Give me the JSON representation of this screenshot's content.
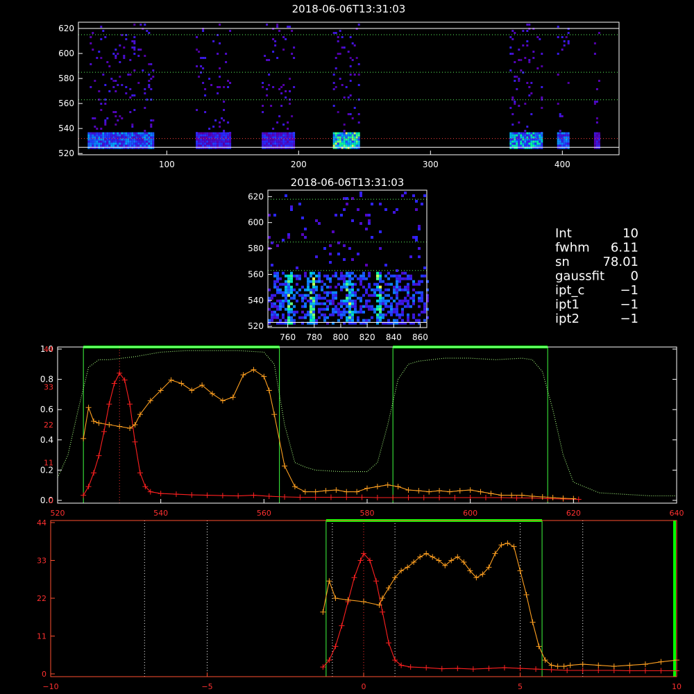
{
  "chart_data": [
    {
      "id": "panel1",
      "type": "heatmap",
      "title": "2018-06-06T13:31:03",
      "xlim": [
        33,
        443
      ],
      "ylim": [
        519,
        625
      ],
      "xticks": [
        100,
        200,
        300,
        400
      ],
      "yticks": [
        520,
        540,
        560,
        580,
        600,
        620
      ],
      "guides_y": [
        615,
        585,
        563,
        532
      ],
      "bands": [
        {
          "x": [
            40,
            90
          ],
          "intensity": 0.6
        },
        {
          "x": [
            122,
            148
          ],
          "intensity": 0.45
        },
        {
          "x": [
            172,
            197
          ],
          "intensity": 0.45
        },
        {
          "x": [
            226,
            245
          ],
          "intensity": 0.9
        },
        {
          "x": [
            360,
            385
          ],
          "intensity": 0.75
        },
        {
          "x": [
            396,
            405
          ],
          "intensity": 0.6
        },
        {
          "x": [
            424,
            428
          ],
          "intensity": 0.4
        }
      ]
    },
    {
      "id": "panel2",
      "type": "heatmap",
      "title": "2018-06-06T13:31:03",
      "xlim": [
        745,
        865
      ],
      "ylim": [
        519,
        625
      ],
      "xticks": [
        760,
        780,
        800,
        820,
        840,
        860
      ],
      "yticks": [
        520,
        540,
        560,
        580,
        600,
        620
      ],
      "guides_y": [
        618,
        585,
        563
      ],
      "hot_columns": [
        760,
        778,
        805,
        828
      ]
    },
    {
      "id": "panel3",
      "type": "line",
      "xlim": [
        520,
        640
      ],
      "xticks": [
        520,
        540,
        560,
        580,
        600,
        620,
        640
      ],
      "yticks_left": [
        "0.0",
        "0.2",
        "0.4",
        "0.6",
        "0.8",
        "1.0"
      ],
      "yticks_red": [
        "0",
        "11",
        "22",
        "33",
        "44"
      ],
      "green_bands": [
        [
          525,
          563
        ],
        [
          585,
          615
        ]
      ],
      "red_center": 532,
      "series": [
        {
          "color": "#ff2020",
          "x": [
            525,
            526,
            527,
            528,
            529,
            530,
            531,
            532,
            533,
            534,
            535,
            536,
            537,
            538,
            540,
            543,
            546,
            549,
            552,
            555,
            558,
            561,
            564,
            567,
            570,
            573,
            576,
            579,
            582,
            585,
            588,
            591,
            594,
            597,
            600,
            603,
            606,
            609,
            612,
            615,
            618,
            621
          ],
          "values": [
            1.5,
            4,
            8,
            13,
            20,
            28,
            34,
            37,
            35,
            28,
            17,
            8,
            4,
            2.5,
            2,
            1.8,
            1.6,
            1.5,
            1.4,
            1.3,
            1.5,
            1.2,
            1.0,
            0.9,
            0.9,
            0.9,
            0.9,
            0.9,
            0.8,
            0.8,
            0.8,
            0.8,
            0.8,
            0.8,
            0.8,
            0.8,
            0.8,
            0.7,
            0.7,
            0.5,
            0.4,
            0.3
          ]
        },
        {
          "color": "#ffa020",
          "x": [
            525,
            526,
            527,
            528,
            530,
            532,
            534,
            535,
            536,
            538,
            540,
            542,
            544,
            546,
            548,
            550,
            552,
            554,
            556,
            558,
            560,
            561,
            562,
            564,
            566,
            568,
            570,
            572,
            574,
            576,
            578,
            580,
            582,
            584,
            586,
            588,
            590,
            592,
            594,
            596,
            598,
            600,
            602,
            604,
            606,
            608,
            610,
            612,
            614,
            616,
            618,
            620
          ],
          "values": [
            18,
            27,
            23,
            22.5,
            22,
            21.5,
            21,
            22,
            25,
            29,
            32,
            35,
            34,
            32,
            33.5,
            31,
            29,
            30,
            36.5,
            38,
            36,
            32,
            25,
            10,
            4,
            2.5,
            2.5,
            2.8,
            3,
            2.5,
            2.5,
            3.5,
            4,
            4.5,
            4,
            3,
            2.8,
            2.5,
            2.8,
            2.5,
            2.8,
            3,
            2.5,
            2,
            1.5,
            1.5,
            1.5,
            1.2,
            1,
            0.8,
            0.6,
            0.5
          ]
        },
        {
          "color": "#a8ff80",
          "dotted": true,
          "x": [
            520,
            522,
            524,
            526,
            528,
            530,
            535,
            540,
            545,
            550,
            555,
            560,
            562,
            564,
            566,
            568,
            570,
            575,
            580,
            582,
            584,
            586,
            588,
            590,
            595,
            600,
            605,
            610,
            612,
            614,
            616,
            618,
            620,
            625,
            630,
            635,
            640
          ],
          "values": [
            0.15,
            0.3,
            0.6,
            0.88,
            0.93,
            0.93,
            0.95,
            0.98,
            0.99,
            0.99,
            0.99,
            0.98,
            0.9,
            0.5,
            0.25,
            0.22,
            0.2,
            0.19,
            0.19,
            0.25,
            0.5,
            0.8,
            0.9,
            0.92,
            0.94,
            0.94,
            0.93,
            0.94,
            0.93,
            0.85,
            0.6,
            0.3,
            0.12,
            0.05,
            0.04,
            0.03,
            0.03
          ]
        }
      ]
    },
    {
      "id": "panel4",
      "type": "line",
      "xlim": [
        -10,
        10
      ],
      "xticks": [
        -10,
        -5,
        0,
        5,
        10
      ],
      "yticks_red": [
        "0",
        "11",
        "22",
        "33",
        "44"
      ],
      "vlines_white": [
        -7,
        -5,
        -1,
        1,
        5,
        7
      ],
      "green_band": [
        -1.2,
        5.7
      ],
      "red_center": 0,
      "series": [
        {
          "color": "#ff2020",
          "x": [
            -1.3,
            -1.1,
            -0.9,
            -0.7,
            -0.5,
            -0.3,
            -0.1,
            0,
            0.2,
            0.4,
            0.6,
            0.8,
            1.0,
            1.2,
            1.5,
            2,
            2.5,
            3,
            3.5,
            4,
            4.5,
            5,
            5.5,
            6,
            6.5,
            7,
            7.5,
            8,
            8.5,
            9,
            9.5,
            10
          ],
          "values": [
            2,
            4,
            8,
            14,
            21,
            28,
            33,
            35,
            33,
            27,
            18,
            9,
            4,
            2.5,
            2,
            1.8,
            1.5,
            1.6,
            1.4,
            1.6,
            1.8,
            1.6,
            1.4,
            1.2,
            1,
            1,
            1,
            1,
            0.9,
            0.9,
            0.9,
            0.9
          ]
        },
        {
          "color": "#ffa020",
          "x": [
            -1.3,
            -1.1,
            -0.9,
            -0.5,
            0,
            0.5,
            0.6,
            0.8,
            1.0,
            1.2,
            1.4,
            1.6,
            1.8,
            2.0,
            2.2,
            2.4,
            2.6,
            2.8,
            3.0,
            3.2,
            3.4,
            3.6,
            3.8,
            4.0,
            4.2,
            4.4,
            4.6,
            4.8,
            5.0,
            5.2,
            5.4,
            5.6,
            5.8,
            6.0,
            6.2,
            6.4,
            6.6,
            7.0,
            7.5,
            8.0,
            8.5,
            9.0,
            9.5,
            10.0
          ],
          "values": [
            18,
            27,
            22,
            21.5,
            21,
            20,
            22,
            25,
            28,
            30,
            31,
            32.5,
            34,
            35,
            34,
            33,
            31.5,
            33,
            34,
            32.5,
            30,
            28,
            29,
            31,
            35,
            37.5,
            38,
            37,
            30,
            23,
            15,
            8,
            4,
            2.5,
            2.2,
            2.2,
            2.5,
            2.8,
            2.5,
            2.2,
            2.5,
            2.8,
            3.5,
            4
          ]
        }
      ]
    }
  ],
  "info_panel": [
    {
      "label": "Int",
      "value": "10"
    },
    {
      "label": "fwhm",
      "value": "6.11"
    },
    {
      "label": "sn",
      "value": "78.01"
    },
    {
      "label": "gaussfit",
      "value": "0"
    },
    {
      "label": "ipt_c",
      "value": "−1"
    },
    {
      "label": "ipt1",
      "value": "−1"
    },
    {
      "label": "ipt2",
      "value": "−1"
    }
  ],
  "colors": {
    "axis": "#ffffff",
    "red": "#ff2020",
    "orange": "#ffa020",
    "green": "#00ff00",
    "guide": "#80ff80"
  }
}
